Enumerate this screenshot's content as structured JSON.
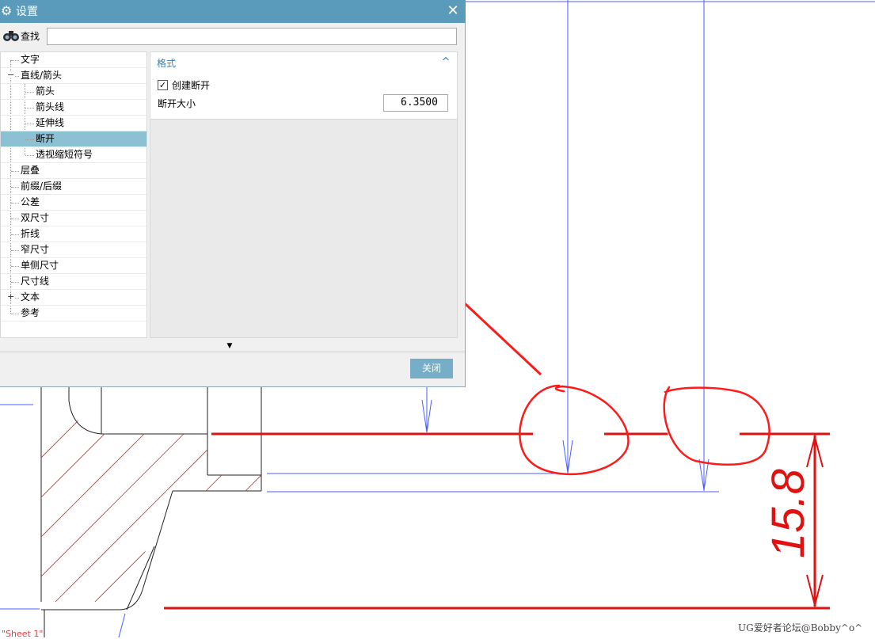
{
  "dialog": {
    "title": "设置",
    "close_glyph": "✕",
    "find_label": "查找",
    "find_value": "",
    "tree": [
      {
        "label": "文字",
        "level": 0
      },
      {
        "label": "直线/箭头",
        "level": 0,
        "expander": "−"
      },
      {
        "label": "箭头",
        "level": 1
      },
      {
        "label": "箭头线",
        "level": 1
      },
      {
        "label": "延伸线",
        "level": 1
      },
      {
        "label": "断开",
        "level": 1,
        "selected": true
      },
      {
        "label": "透视缩短符号",
        "level": 1
      },
      {
        "label": "层叠",
        "level": 0
      },
      {
        "label": "前缀/后缀",
        "level": 0
      },
      {
        "label": "公差",
        "level": 0
      },
      {
        "label": "双尺寸",
        "level": 0
      },
      {
        "label": "折线",
        "level": 0
      },
      {
        "label": "窄尺寸",
        "level": 0
      },
      {
        "label": "单侧尺寸",
        "level": 0
      },
      {
        "label": "尺寸线",
        "level": 0
      },
      {
        "label": "文本",
        "level": 0,
        "expander": "+"
      },
      {
        "label": "参考",
        "level": 0
      }
    ],
    "group": {
      "title": "格式",
      "collapse_glyph": "^",
      "create_break_label": "创建断开",
      "create_break_checked": true,
      "break_size_label": "断开大小",
      "break_size_value": "6.3500"
    },
    "more_glyph": "▼",
    "close_button": "关闭"
  },
  "drawing": {
    "dimension_value": "15.8",
    "watermark": "UG爱好者论坛@Bobby^o^",
    "sheet_label": "\"Sheet 1\""
  },
  "colors": {
    "titlebar": "#5a9aba",
    "selected": "#8cc0d3",
    "button": "#76aec7",
    "annotation_red": "#ff1a1a",
    "dim_red": "#e21111",
    "blue_line": "#4a5cff"
  }
}
